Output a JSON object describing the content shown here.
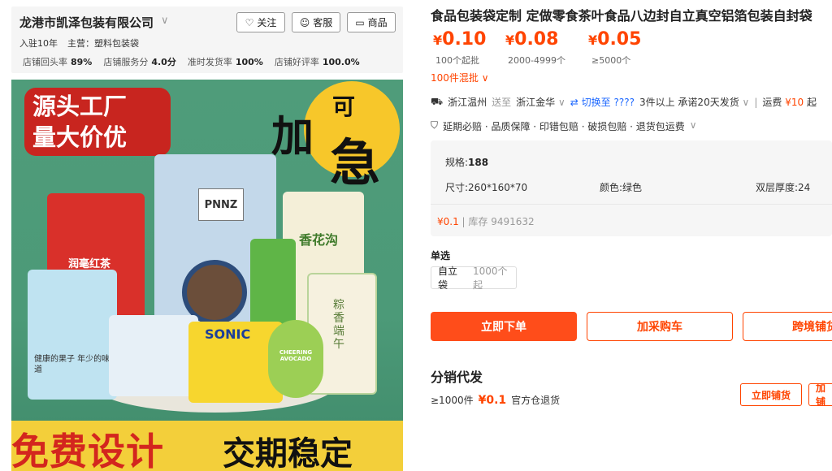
{
  "shop": {
    "name": "龙港市凯泽包装有限公司",
    "follow_label": "关注",
    "service_label": "客服",
    "products_label": "商品",
    "years": "入驻10年",
    "main_business": "主营：塑料包装袋",
    "stats": [
      {
        "label": "店铺回头率",
        "value": "89%"
      },
      {
        "label": "店铺服务分",
        "value": "4.0分"
      },
      {
        "label": "准时发货率",
        "value": "100%"
      },
      {
        "label": "店铺好评率",
        "value": "100.0%"
      }
    ]
  },
  "image": {
    "tag_line1": "源头工厂",
    "tag_line2": "量大价优",
    "brush_text_1": "加",
    "brush_text_2": "急",
    "brush_small": "可",
    "banner_red": "免费设计",
    "banner_black": "交期稳定",
    "bag_labels": [
      "润毫红茶",
      "PNNZ",
      "香花沟",
      "SONIC",
      "粽香端午",
      "CHEERING AVOCADO",
      "健康的果子 年少的味道"
    ]
  },
  "product": {
    "title": "食品包装袋定制 定做零食茶叶食品八边封自立真空铝箔包装自封袋",
    "prices": [
      {
        "currency": "¥",
        "value": "0.10",
        "qty": "100个起批"
      },
      {
        "currency": "¥",
        "value": "0.08",
        "qty": "2000-4999个"
      },
      {
        "currency": "¥",
        "value": "0.05",
        "qty": "≥5000个"
      }
    ],
    "mix_label": "100件混批 ∨"
  },
  "shipping": {
    "from": "浙江温州",
    "to_word": "送至",
    "to": "浙江金华",
    "switch_label": "切换至",
    "switch_target": "????",
    "promise": "3件以上  承诺20天发货",
    "fee_label": "运费",
    "fee": "¥10",
    "fee_suffix": "起"
  },
  "services": {
    "text": "延期必赔 · 品质保障 · 印错包赔 · 破损包赔 · 退货包运费"
  },
  "spec": {
    "spec_label": "规格:",
    "spec_value": "188",
    "size": "尺寸:260*160*70",
    "color": "颜色:绿色",
    "thickness": "双层厚度:24",
    "price": "¥0.1",
    "stock": "库存 9491632"
  },
  "option": {
    "heading": "单选",
    "name": "自立袋",
    "min": "1000个起"
  },
  "actions": {
    "buy": "立即下单",
    "cart": "加采购车",
    "cross": "跨境铺货"
  },
  "distribution": {
    "title": "分销代发",
    "min_qty": "≥1000件",
    "price": "¥0.1",
    "return_text": "官方仓退货",
    "publish_btn": "立即铺货",
    "more_btn": "加铺"
  },
  "colors": {
    "accent": "#ff4400",
    "link": "#1a66ff",
    "image_bg": "#4f9c7a"
  }
}
